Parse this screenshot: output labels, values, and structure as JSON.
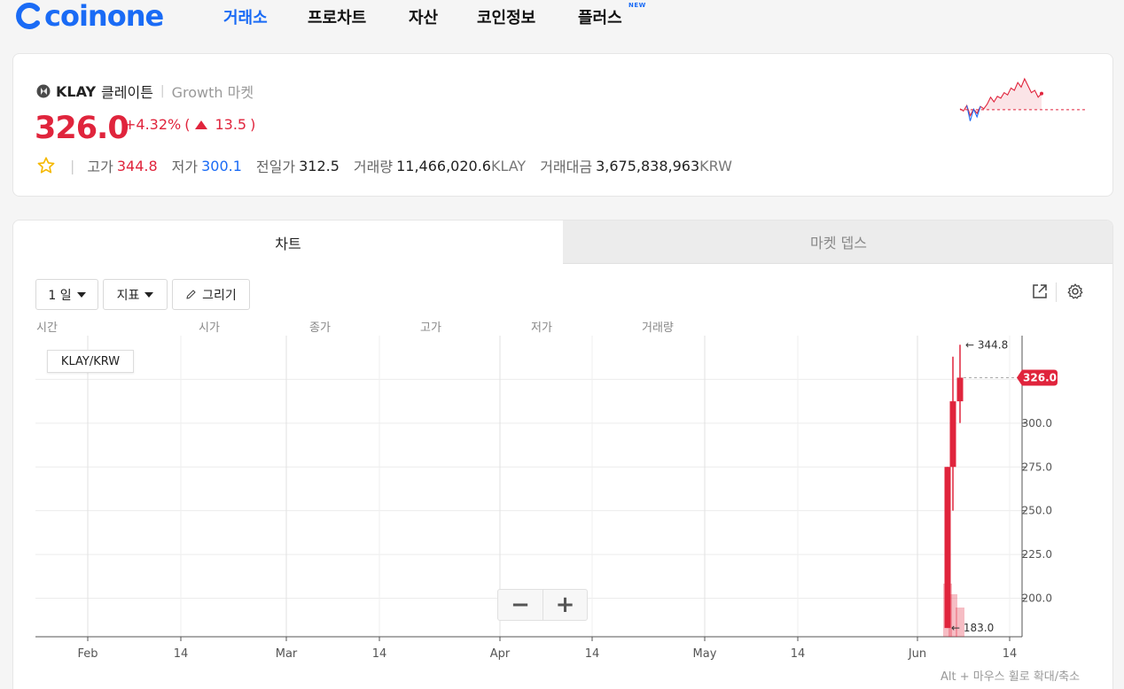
{
  "brand": {
    "logo_text": "coinone",
    "accent": "#1a6bf5"
  },
  "nav": {
    "items": [
      {
        "label": "거래소",
        "active": true
      },
      {
        "label": "프로차트",
        "active": false
      },
      {
        "label": "자산",
        "active": false
      },
      {
        "label": "코인정보",
        "active": false
      },
      {
        "label": "플러스",
        "active": false,
        "badge": "NEW"
      }
    ]
  },
  "ticker": {
    "symbol": "KLAY",
    "name_kor": "클레이튼",
    "market": "Growth 마켓",
    "price": "326.0",
    "change_pct": "+4.32%",
    "change_abs": "13.5",
    "high_label": "고가",
    "high": "344.8",
    "low_label": "저가",
    "low": "300.1",
    "prev_label": "전일가",
    "prev": "312.5",
    "volume_label": "거래량",
    "volume": "11,466,020.6",
    "volume_unit": "KLAY",
    "amount_label": "거래대금",
    "amount": "3,675,838,963",
    "amount_unit": "KRW",
    "up_color": "#e0243c",
    "down_color": "#1a6bf5"
  },
  "tabs": {
    "chart": "차트",
    "depth": "마켓 뎁스"
  },
  "toolbar": {
    "interval": "1 일",
    "indicator": "지표",
    "draw": "그리기"
  },
  "ohlc_header": {
    "time": "시간",
    "open": "시가",
    "close": "종가",
    "high": "고가",
    "low": "저가",
    "volume": "거래량"
  },
  "chart": {
    "symbol_label": "KLAY/KRW",
    "zoom_minus": "−",
    "zoom_plus": "+",
    "hint": "Alt + 마우스 휠로 확대/축소"
  },
  "chart_data": {
    "type": "candlestick",
    "pair": "KLAY/KRW",
    "interval": "1D",
    "x_tick_labels": [
      "Feb",
      "14",
      "Mar",
      "14",
      "Apr",
      "14",
      "May",
      "14",
      "Jun",
      "14"
    ],
    "y_tick_labels": [
      "200.0",
      "225.0",
      "250.0",
      "275.0",
      "300.0"
    ],
    "ylim": [
      178,
      350
    ],
    "last_price": 326.0,
    "max_marker": 344.8,
    "min_marker": 183.0,
    "candles": [
      {
        "open": 183.0,
        "high": 275.0,
        "low": 183.0,
        "close": 275.0,
        "volume_rel": 1.0
      },
      {
        "open": 275.0,
        "high": 338.0,
        "low": 250.0,
        "close": 312.5,
        "volume_rel": 0.8
      },
      {
        "open": 312.5,
        "high": 344.8,
        "low": 300.1,
        "close": 326.0,
        "volume_rel": 0.55
      }
    ],
    "grid": true
  },
  "sparkline": {
    "values": [
      0.35,
      0.3,
      0.42,
      0.2,
      0.34,
      0.25,
      0.4,
      0.35,
      0.45,
      0.6,
      0.5,
      0.62,
      0.58,
      0.7,
      0.65,
      0.8,
      0.75,
      0.92,
      0.82,
      1.0,
      0.85,
      0.7,
      0.75,
      0.6,
      0.68
    ],
    "baseline": 0.33
  }
}
